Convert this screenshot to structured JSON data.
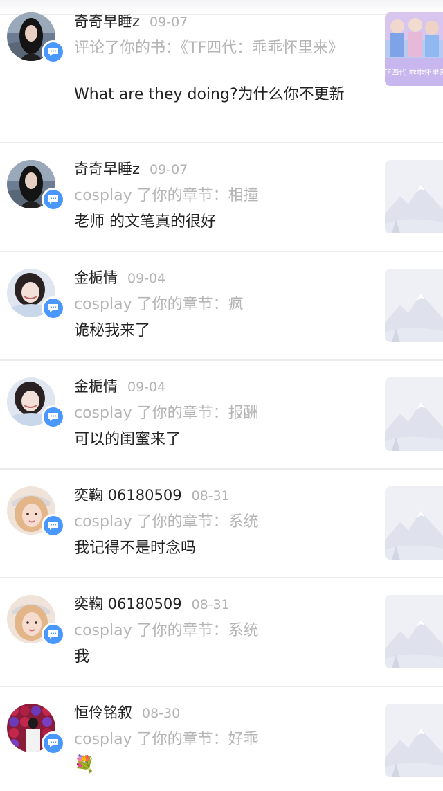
{
  "notifications": [
    {
      "name": "奇奇早睡z",
      "date": "09-07",
      "action": "评论了你的书：《TF四代：乖乖怀里来》",
      "content": "What are they doing?为什么你不更新",
      "avatar_icon": "dark-hair-girl-avatar",
      "thumb_icon": "book-cover-thumbnail",
      "thumb_text": "TF四代 乖乖怀里来"
    },
    {
      "name": "奇奇早睡z",
      "date": "09-07",
      "action": "cosplay 了你的章节：相撞",
      "content": "老师 的文笔真的很好",
      "avatar_icon": "dark-hair-girl-avatar",
      "thumb_icon": "mountain-placeholder-icon"
    },
    {
      "name": "金栀情",
      "date": "09-04",
      "action": "cosplay 了你的章节：疯",
      "content": "诡秘我来了",
      "avatar_icon": "smiling-girl-avatar",
      "thumb_icon": "mountain-placeholder-icon"
    },
    {
      "name": "金栀情",
      "date": "09-04",
      "action": "cosplay 了你的章节：报酬",
      "content": "可以的闺蜜来了",
      "avatar_icon": "smiling-girl-avatar",
      "thumb_icon": "mountain-placeholder-icon"
    },
    {
      "name": "奕鞠 06180509",
      "date": "08-31",
      "action": "cosplay 了你的章节：系统",
      "content": "我记得不是时念吗",
      "avatar_icon": "blonde-girl-cap-avatar",
      "thumb_icon": "mountain-placeholder-icon"
    },
    {
      "name": "奕鞠 06180509",
      "date": "08-31",
      "action": "cosplay 了你的章节：系统",
      "content": "我",
      "avatar_icon": "blonde-girl-cap-avatar",
      "thumb_icon": "mountain-placeholder-icon"
    },
    {
      "name": "恒伶铭叙",
      "date": "08-30",
      "action": "cosplay 了你的章节：好乖",
      "content": "💐",
      "avatar_icon": "balloon-wall-avatar",
      "thumb_icon": "mountain-placeholder-icon"
    }
  ],
  "colors": {
    "badge": "#4a98ff",
    "name": "#222222",
    "meta": "#b3b3b3",
    "placeholder_bg": "#eef0f6"
  }
}
